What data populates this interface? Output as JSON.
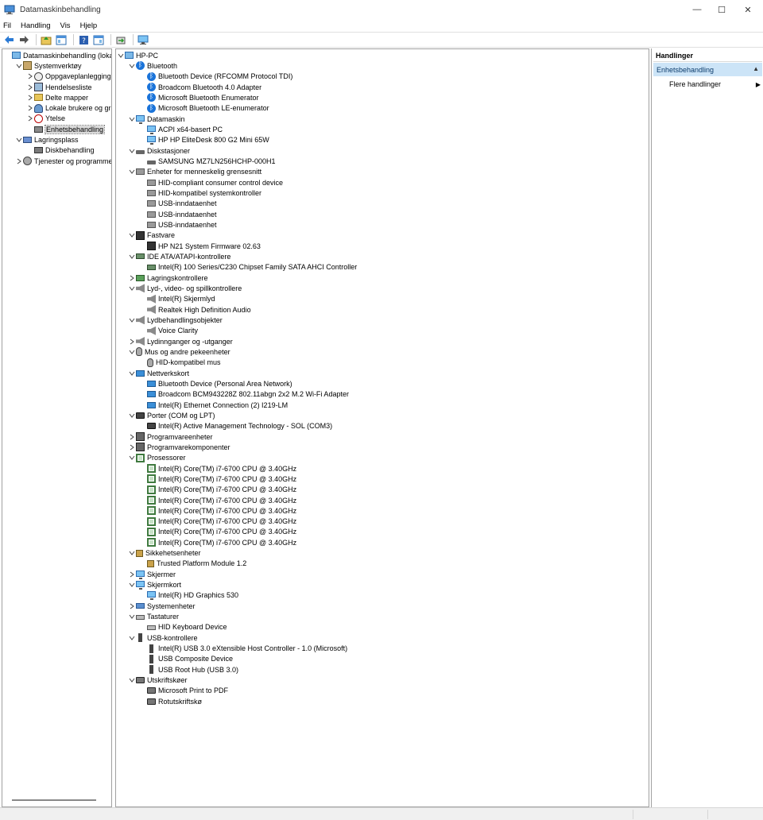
{
  "window": {
    "title": "Datamaskinbehandling",
    "minimize": "—",
    "maximize": "☐",
    "close": "✕"
  },
  "menu": [
    "Fil",
    "Handling",
    "Vis",
    "Hjelp"
  ],
  "toolbar_icons": [
    "back-arrow-icon",
    "forward-arrow-icon",
    "up-folder-icon",
    "show-hide-tree-icon",
    "help-icon",
    "properties-icon",
    "export-icon",
    "monitor-icon"
  ],
  "left_tree": [
    {
      "label": "Datamaskinbehandling (lokal)",
      "icon": "pc",
      "level": 0,
      "exp": ""
    },
    {
      "label": "Systemverktøy",
      "icon": "tools",
      "level": 1,
      "exp": "v"
    },
    {
      "label": "Oppgaveplanlegging",
      "icon": "clock",
      "level": 2,
      "exp": ">"
    },
    {
      "label": "Hendelsesliste",
      "icon": "log",
      "level": 2,
      "exp": ">"
    },
    {
      "label": "Delte mapper",
      "icon": "folder",
      "level": 2,
      "exp": ">"
    },
    {
      "label": "Lokale brukere og grupp",
      "icon": "users",
      "level": 2,
      "exp": ">"
    },
    {
      "label": "Ytelse",
      "icon": "perf",
      "level": 2,
      "exp": ">"
    },
    {
      "label": "Enhetsbehandling",
      "icon": "devmgr",
      "level": 2,
      "exp": "",
      "selected": true
    },
    {
      "label": "Lagringsplass",
      "icon": "store",
      "level": 1,
      "exp": "v"
    },
    {
      "label": "Diskbehandling",
      "icon": "diskmgmt",
      "level": 2,
      "exp": ""
    },
    {
      "label": "Tjenester og programmer",
      "icon": "services",
      "level": 1,
      "exp": ">"
    }
  ],
  "device_tree": [
    {
      "label": "HP-PC",
      "icon": "pc",
      "level": 0,
      "exp": "v"
    },
    {
      "label": "Bluetooth",
      "icon": "bt",
      "level": 1,
      "exp": "v"
    },
    {
      "label": "Bluetooth Device (RFCOMM Protocol TDI)",
      "icon": "bt",
      "level": 2
    },
    {
      "label": "Broadcom Bluetooth 4.0 Adapter",
      "icon": "bt",
      "level": 2
    },
    {
      "label": "Microsoft Bluetooth Enumerator",
      "icon": "bt",
      "level": 2
    },
    {
      "label": "Microsoft Bluetooth LE-enumerator",
      "icon": "bt",
      "level": 2
    },
    {
      "label": "Datamaskin",
      "icon": "monitor",
      "level": 1,
      "exp": "v"
    },
    {
      "label": "ACPI x64-basert PC",
      "icon": "monitor",
      "level": 2
    },
    {
      "label": "HP HP EliteDesk 800 G2 Mini 65W",
      "icon": "monitor",
      "level": 2
    },
    {
      "label": "Diskstasjoner",
      "icon": "disk",
      "level": 1,
      "exp": "v"
    },
    {
      "label": "SAMSUNG MZ7LN256HCHP-000H1",
      "icon": "disk",
      "level": 2
    },
    {
      "label": "Enheter for menneskelig grensesnitt",
      "icon": "hid",
      "level": 1,
      "exp": "v"
    },
    {
      "label": "HID-compliant consumer control device",
      "icon": "hid",
      "level": 2
    },
    {
      "label": "HID-kompatibel systemkontroller",
      "icon": "hid",
      "level": 2
    },
    {
      "label": "USB-inndataenhet",
      "icon": "hid",
      "level": 2
    },
    {
      "label": "USB-inndataenhet",
      "icon": "hid",
      "level": 2
    },
    {
      "label": "USB-inndataenhet",
      "icon": "hid",
      "level": 2
    },
    {
      "label": "Fastvare",
      "icon": "fw",
      "level": 1,
      "exp": "v"
    },
    {
      "label": "HP N21 System Firmware 02.63",
      "icon": "fw",
      "level": 2
    },
    {
      "label": "IDE ATA/ATAPI-kontrollere",
      "icon": "ide",
      "level": 1,
      "exp": "v"
    },
    {
      "label": "Intel(R) 100 Series/C230 Chipset Family SATA AHCI Controller",
      "icon": "ide",
      "level": 2
    },
    {
      "label": "Lagringskontrollere",
      "icon": "storage",
      "level": 1,
      "exp": ">"
    },
    {
      "label": "Lyd-, video- og spillkontrollere",
      "icon": "audio",
      "level": 1,
      "exp": "v"
    },
    {
      "label": "Intel(R) Skjermlyd",
      "icon": "audio",
      "level": 2
    },
    {
      "label": "Realtek High Definition Audio",
      "icon": "audio",
      "level": 2
    },
    {
      "label": "Lydbehandlingsobjekter",
      "icon": "audio",
      "level": 1,
      "exp": "v"
    },
    {
      "label": "Voice Clarity",
      "icon": "audio",
      "level": 2
    },
    {
      "label": "Lydinnganger og -utganger",
      "icon": "audio",
      "level": 1,
      "exp": ">"
    },
    {
      "label": "Mus og andre pekeenheter",
      "icon": "mouse",
      "level": 1,
      "exp": "v"
    },
    {
      "label": "HID-kompatibel mus",
      "icon": "mouse",
      "level": 2
    },
    {
      "label": "Nettverkskort",
      "icon": "net",
      "level": 1,
      "exp": "v"
    },
    {
      "label": "Bluetooth Device (Personal Area Network)",
      "icon": "net",
      "level": 2
    },
    {
      "label": "Broadcom BCM943228Z 802.11abgn 2x2 M.2 Wi-Fi Adapter",
      "icon": "net",
      "level": 2
    },
    {
      "label": "Intel(R) Ethernet Connection (2) I219-LM",
      "icon": "net",
      "level": 2
    },
    {
      "label": "Porter (COM og LPT)",
      "icon": "port",
      "level": 1,
      "exp": "v"
    },
    {
      "label": "Intel(R) Active Management Technology - SOL (COM3)",
      "icon": "port",
      "level": 2
    },
    {
      "label": "Programvareenheter",
      "icon": "sw",
      "level": 1,
      "exp": ">"
    },
    {
      "label": "Programvarekomponenter",
      "icon": "sw",
      "level": 1,
      "exp": ">"
    },
    {
      "label": "Prosessorer",
      "icon": "cpu",
      "level": 1,
      "exp": "v"
    },
    {
      "label": "Intel(R) Core(TM) i7-6700 CPU @ 3.40GHz",
      "icon": "cpu",
      "level": 2
    },
    {
      "label": "Intel(R) Core(TM) i7-6700 CPU @ 3.40GHz",
      "icon": "cpu",
      "level": 2
    },
    {
      "label": "Intel(R) Core(TM) i7-6700 CPU @ 3.40GHz",
      "icon": "cpu",
      "level": 2
    },
    {
      "label": "Intel(R) Core(TM) i7-6700 CPU @ 3.40GHz",
      "icon": "cpu",
      "level": 2
    },
    {
      "label": "Intel(R) Core(TM) i7-6700 CPU @ 3.40GHz",
      "icon": "cpu",
      "level": 2
    },
    {
      "label": "Intel(R) Core(TM) i7-6700 CPU @ 3.40GHz",
      "icon": "cpu",
      "level": 2
    },
    {
      "label": "Intel(R) Core(TM) i7-6700 CPU @ 3.40GHz",
      "icon": "cpu",
      "level": 2
    },
    {
      "label": "Intel(R) Core(TM) i7-6700 CPU @ 3.40GHz",
      "icon": "cpu",
      "level": 2
    },
    {
      "label": "Sikkehetsenheter",
      "icon": "sec",
      "level": 1,
      "exp": "v"
    },
    {
      "label": "Trusted Platform Module 1.2",
      "icon": "sec",
      "level": 2
    },
    {
      "label": "Skjermer",
      "icon": "monitor",
      "level": 1,
      "exp": ">"
    },
    {
      "label": "Skjermkort",
      "icon": "monitor",
      "level": 1,
      "exp": "v"
    },
    {
      "label": "Intel(R) HD Graphics 530",
      "icon": "monitor",
      "level": 2
    },
    {
      "label": "Systemenheter",
      "icon": "sys",
      "level": 1,
      "exp": ">"
    },
    {
      "label": "Tastaturer",
      "icon": "kbd",
      "level": 1,
      "exp": "v"
    },
    {
      "label": "HID Keyboard Device",
      "icon": "kbd",
      "level": 2
    },
    {
      "label": "USB-kontrollere",
      "icon": "usb",
      "level": 1,
      "exp": "v"
    },
    {
      "label": "Intel(R) USB 3.0 eXtensible Host Controller - 1.0 (Microsoft)",
      "icon": "usb",
      "level": 2
    },
    {
      "label": "USB Composite Device",
      "icon": "usb",
      "level": 2
    },
    {
      "label": "USB Root Hub (USB 3.0)",
      "icon": "usb",
      "level": 2
    },
    {
      "label": "Utskriftskøer",
      "icon": "printer",
      "level": 1,
      "exp": "v"
    },
    {
      "label": "Microsoft Print to PDF",
      "icon": "printer",
      "level": 2
    },
    {
      "label": "Rotutskriftskø",
      "icon": "printer",
      "level": 2
    }
  ],
  "actions": {
    "header": "Handlinger",
    "section": "Enhetsbehandling",
    "section_chevron": "▲",
    "item": "Flere handlinger",
    "item_arrow": "▶"
  },
  "colors": {
    "selection": "#cce4f7",
    "border": "#a0a0a0"
  }
}
